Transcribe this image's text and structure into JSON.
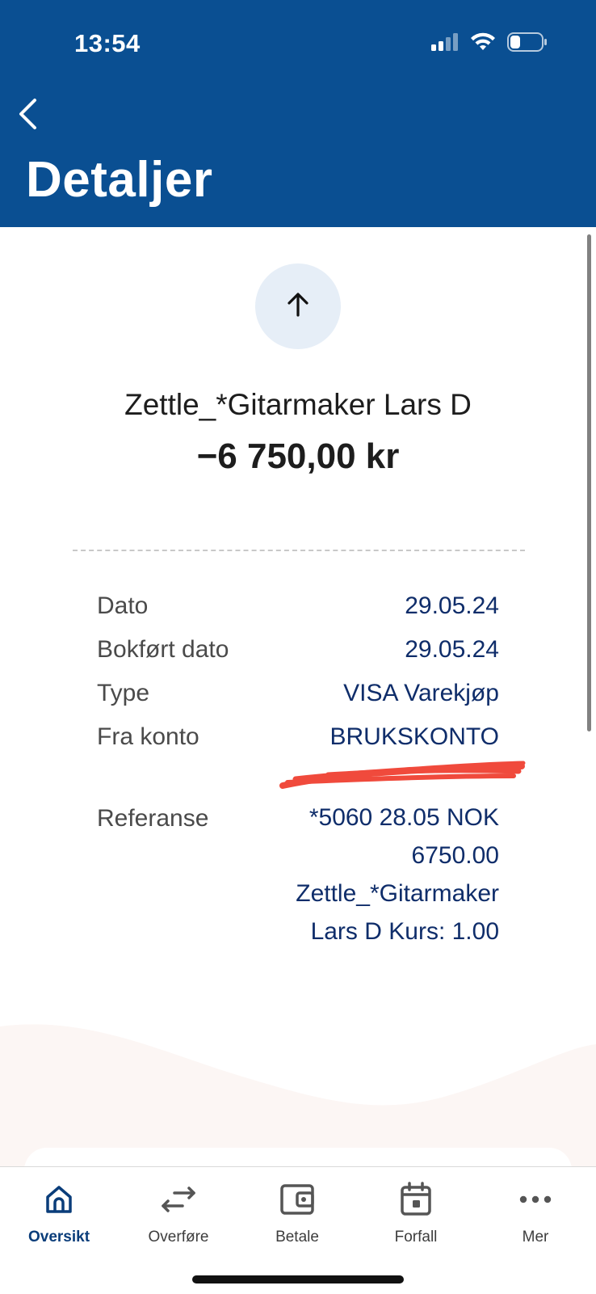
{
  "status_bar": {
    "time": "13:54",
    "signal_icon": "signal-bars-icon",
    "wifi_icon": "wifi-icon",
    "battery_icon": "battery-icon"
  },
  "header": {
    "back_icon": "chevron-left-icon",
    "title": "Detaljer",
    "background_color": "#0a4f92"
  },
  "transaction": {
    "direction_icon": "arrow-up-icon",
    "merchant": "Zettle_*Gitarmaker Lars D",
    "amount": "−6 750,00 kr"
  },
  "details": [
    {
      "label": "Dato",
      "value": "29.05.24"
    },
    {
      "label": "Bokført dato",
      "value": "29.05.24"
    },
    {
      "label": "Type",
      "value": "VISA Varekjøp"
    },
    {
      "label": "Fra konto",
      "value": "BRUKSKONTO"
    }
  ],
  "reference": {
    "label": "Referanse",
    "lines": [
      "*5060 28.05 NOK",
      "6750.00",
      "Zettle_*Gitarmaker",
      "Lars D Kurs: 1.00"
    ]
  },
  "tabbar": {
    "tabs": [
      {
        "label": "Oversikt",
        "icon": "home-icon",
        "active": true
      },
      {
        "label": "Overføre",
        "icon": "transfer-arrows-icon",
        "active": false
      },
      {
        "label": "Betale",
        "icon": "wallet-icon",
        "active": false
      },
      {
        "label": "Forfall",
        "icon": "calendar-icon",
        "active": false
      },
      {
        "label": "Mer",
        "icon": "more-dots-icon",
        "active": false
      }
    ]
  },
  "colors": {
    "primary": "#0a4f92",
    "value_text": "#0f2d6a",
    "redaction": "#f04a3c"
  }
}
